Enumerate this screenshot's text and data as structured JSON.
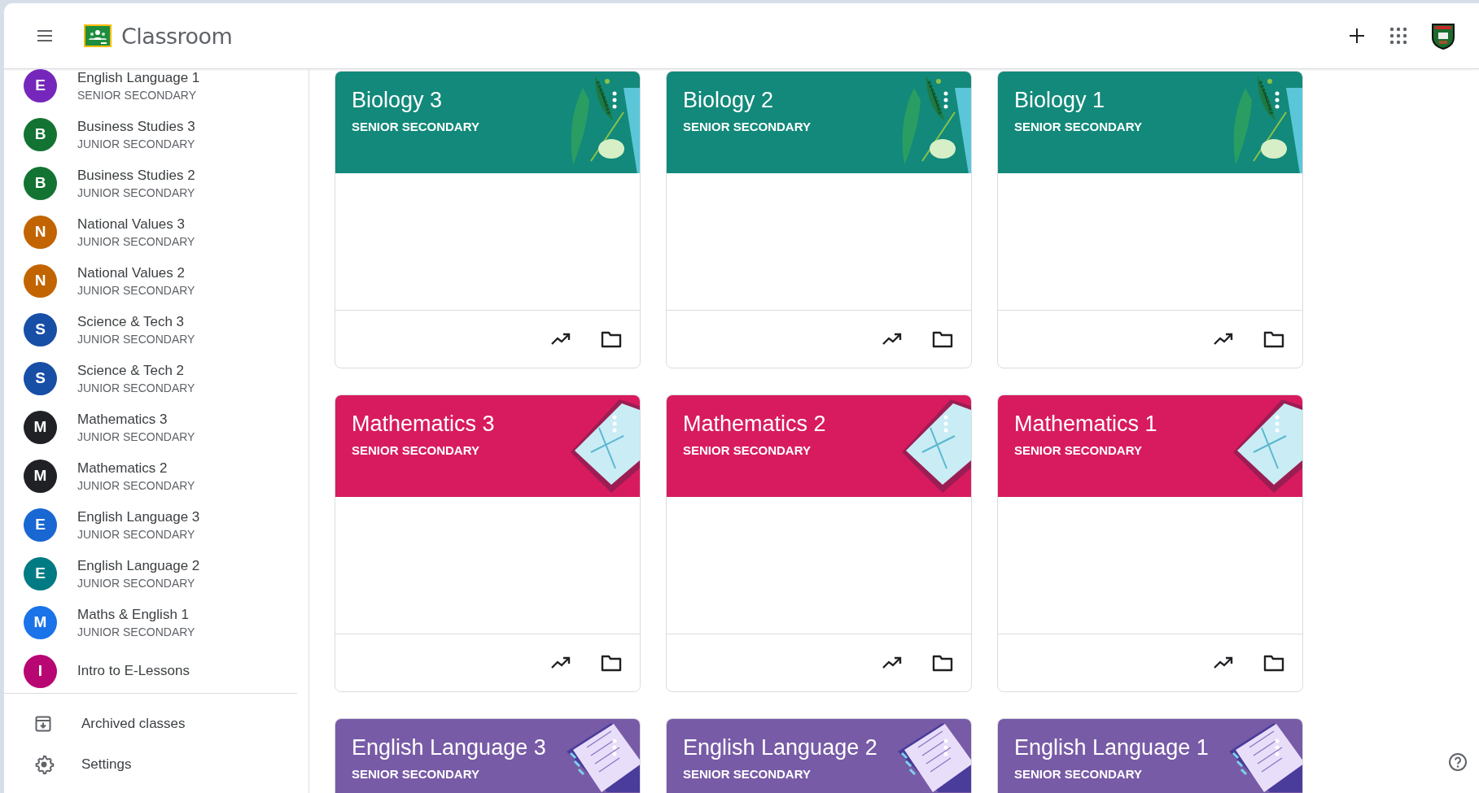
{
  "app": {
    "title": "Classroom"
  },
  "sidebar": {
    "classes": [
      {
        "initial": "E",
        "name": "English Language 1",
        "section": "SENIOR SECONDARY",
        "color": "#7627bb"
      },
      {
        "initial": "B",
        "name": "Business Studies 3",
        "section": "JUNIOR SECONDARY",
        "color": "#137333"
      },
      {
        "initial": "B",
        "name": "Business Studies 2",
        "section": "JUNIOR SECONDARY",
        "color": "#137333"
      },
      {
        "initial": "N",
        "name": "National Values 3",
        "section": "JUNIOR SECONDARY",
        "color": "#c26401"
      },
      {
        "initial": "N",
        "name": "National Values 2",
        "section": "JUNIOR SECONDARY",
        "color": "#c26401"
      },
      {
        "initial": "S",
        "name": "Science & Tech 3",
        "section": "JUNIOR SECONDARY",
        "color": "#174ea6"
      },
      {
        "initial": "S",
        "name": "Science & Tech 2",
        "section": "JUNIOR SECONDARY",
        "color": "#174ea6"
      },
      {
        "initial": "M",
        "name": "Mathematics 3",
        "section": "JUNIOR SECONDARY",
        "color": "#202124"
      },
      {
        "initial": "M",
        "name": "Mathematics 2",
        "section": "JUNIOR SECONDARY",
        "color": "#202124"
      },
      {
        "initial": "E",
        "name": "English Language 3",
        "section": "JUNIOR SECONDARY",
        "color": "#1967d2"
      },
      {
        "initial": "E",
        "name": "English Language 2",
        "section": "JUNIOR SECONDARY",
        "color": "#007b83"
      },
      {
        "initial": "M",
        "name": "Maths & English 1",
        "section": "JUNIOR SECONDARY",
        "color": "#1a73e8"
      },
      {
        "initial": "I",
        "name": "Intro to E-Lessons",
        "color": "#b80672"
      }
    ],
    "footer": [
      {
        "kind": "archive",
        "label": "Archived classes"
      },
      {
        "kind": "settings",
        "label": "Settings"
      }
    ]
  },
  "cards": [
    {
      "title": "Biology 3",
      "section": "SENIOR SECONDARY",
      "kind": "biology",
      "color": "#12897a"
    },
    {
      "title": "Biology 2",
      "section": "SENIOR SECONDARY",
      "kind": "biology",
      "color": "#12897a"
    },
    {
      "title": "Biology 1",
      "section": "SENIOR SECONDARY",
      "kind": "biology",
      "color": "#12897a"
    },
    {
      "title": "Mathematics 3",
      "section": "SENIOR SECONDARY",
      "kind": "math",
      "color": "#d81b5e"
    },
    {
      "title": "Mathematics 2",
      "section": "SENIOR SECONDARY",
      "kind": "math",
      "color": "#d81b5e"
    },
    {
      "title": "Mathematics 1",
      "section": "SENIOR SECONDARY",
      "kind": "math",
      "color": "#d81b5e"
    },
    {
      "title": "English Language 3",
      "section": "SENIOR SECONDARY",
      "kind": "english",
      "color": "#785ba6"
    },
    {
      "title": "English Language 2",
      "section": "SENIOR SECONDARY",
      "kind": "english",
      "color": "#785ba6"
    },
    {
      "title": "English Language 1",
      "section": "SENIOR SECONDARY",
      "kind": "english",
      "color": "#785ba6"
    }
  ]
}
